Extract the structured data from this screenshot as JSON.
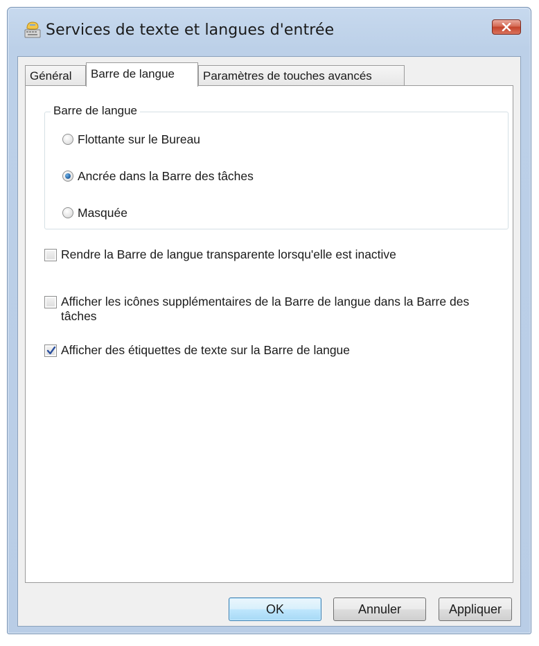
{
  "window": {
    "title": "Services de texte et langues d'entrée",
    "icon": "language-services-icon",
    "close_icon": "close-icon"
  },
  "tabs": [
    {
      "label": "Général",
      "active": false
    },
    {
      "label": "Barre de langue",
      "active": true
    },
    {
      "label": "Paramètres de touches avancés",
      "active": false
    }
  ],
  "group": {
    "title": "Barre de langue",
    "options": [
      {
        "label": "Flottante sur le Bureau",
        "checked": false
      },
      {
        "label": "Ancrée dans la Barre des tâches",
        "checked": true
      },
      {
        "label": "Masquée",
        "checked": false
      }
    ]
  },
  "checkboxes": [
    {
      "label": "Rendre la Barre de langue transparente lorsqu'elle est inactive",
      "checked": false
    },
    {
      "label": "Afficher les icônes supplémentaires de la Barre de langue dans la Barre des tâches",
      "checked": false
    },
    {
      "label": "Afficher des étiquettes de texte sur la Barre de langue",
      "checked": true
    }
  ],
  "buttons": {
    "ok": "OK",
    "cancel": "Annuler",
    "apply": "Appliquer"
  },
  "colors": {
    "titlebar": "#bcd0e8",
    "close_button": "#c4432b",
    "default_button_border": "#3c7fb1"
  }
}
